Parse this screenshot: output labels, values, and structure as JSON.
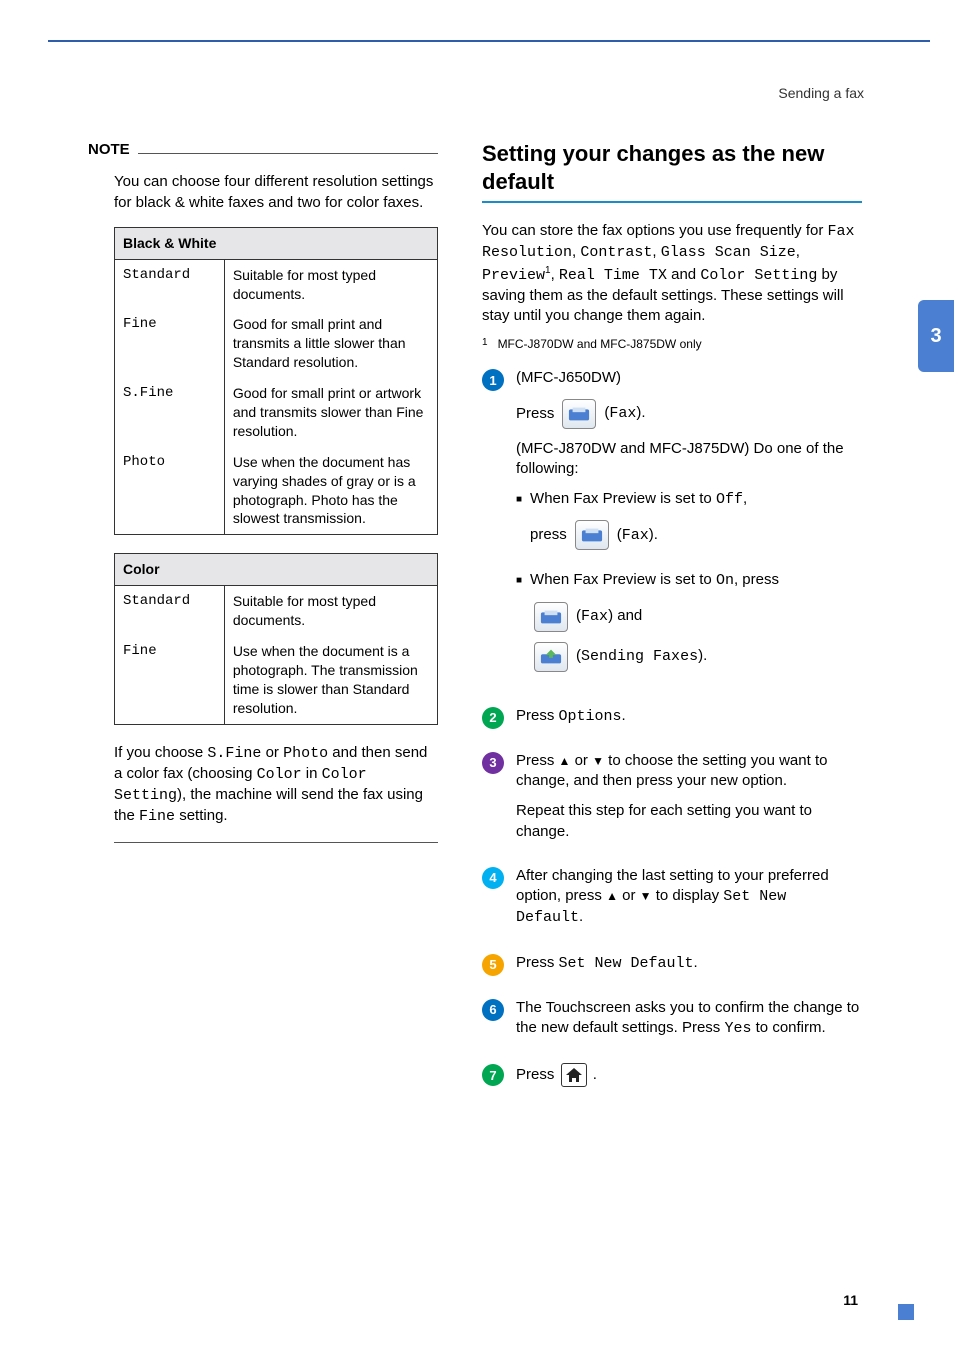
{
  "header": {
    "breadcrumb": "Sending a fax"
  },
  "sideTab": {
    "chapter": "3"
  },
  "pageNumber": "11",
  "note": {
    "label": "NOTE",
    "intro": "You can choose four different resolution settings for black & white faxes and two for color faxes.",
    "bwHeader": "Black & White",
    "bwRows": [
      {
        "k": "Standard",
        "v": "Suitable for most typed documents."
      },
      {
        "k": "Fine",
        "v": "Good for small print and transmits a little slower than Standard resolution."
      },
      {
        "k": "S.Fine",
        "v": "Good for small print or artwork and transmits slower than Fine resolution."
      },
      {
        "k": "Photo",
        "v": "Use when the document has varying shades of gray or is a photograph. Photo has the slowest transmission."
      }
    ],
    "colorHeader": "Color",
    "colorRows": [
      {
        "k": "Standard",
        "v": "Suitable for most typed documents."
      },
      {
        "k": "Fine",
        "v": "Use when the document is a photograph. The transmission time is slower than Standard resolution."
      }
    ],
    "after1a": "If you choose ",
    "after1b": "S.Fine",
    "after1c": " or ",
    "after1d": "Photo",
    "after1e": " and then send a color fax (choosing ",
    "after1f": "Color",
    "after1g": " in ",
    "after1h": "Color Setting",
    "after1i": "), the machine will send the fax using the ",
    "after1j": "Fine",
    "after1k": " setting."
  },
  "section": {
    "title": "Setting your changes as the new default",
    "introA": "You can store the fax options you use frequently for ",
    "opt1": "Fax Resolution",
    "comma": ", ",
    "opt2": "Contrast",
    "opt3": "Glass Scan Size",
    "opt4": "Preview",
    "opt5": "Real Time TX",
    "and": " and ",
    "opt6": "Color Setting",
    "introB": " by saving them as the default settings. These settings will stay until you change them again.",
    "footnoteNum": "1",
    "footnote": "MFC-J870DW and MFC-J875DW only",
    "step1": {
      "model1": "(MFC-J650DW)",
      "press": "Press ",
      "faxLabel": "Fax",
      "model2": "(MFC-J870DW and MFC-J875DW) Do one of the following:",
      "sub1a": "When Fax Preview is set to ",
      "off": "Off",
      "sub1b": ",",
      "pressLower": "press ",
      "sub2a": "When Fax Preview is set to ",
      "on": "On",
      "sub2b": ", press",
      "andWord": " and",
      "sendingFaxes": "Sending Faxes"
    },
    "step2a": "Press ",
    "step2b": "Options",
    "step2c": ".",
    "step3a": "Press ",
    "step3b": " or ",
    "step3c": " to choose the setting you want to change, and then press your new option.",
    "step3d": "Repeat this step for each setting you want to change.",
    "step4a": "After changing the last setting to your preferred option, press ",
    "step4b": " or ",
    "step4c": " to display ",
    "step4d": "Set New Default",
    "step4e": ".",
    "step5a": "Press ",
    "step5b": "Set New Default",
    "step5c": ".",
    "step6a": "The Touchscreen asks you to confirm the change to the new default settings. Press ",
    "step6b": "Yes",
    "step6c": " to confirm.",
    "step7": "Press ",
    "step7b": "."
  }
}
